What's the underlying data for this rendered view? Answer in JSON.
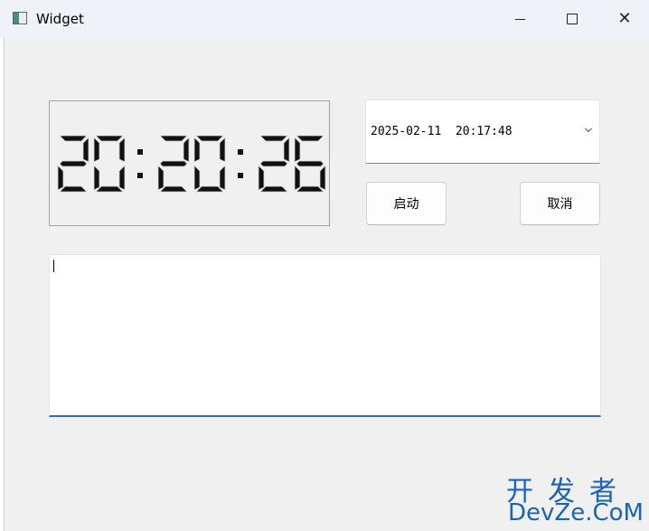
{
  "window": {
    "title": "Widget"
  },
  "clock": {
    "digits": [
      "2",
      "0",
      "2",
      "0",
      "2",
      "6"
    ]
  },
  "datetime_edit": {
    "value": "2025-02-11  20:17:48"
  },
  "buttons": {
    "start_label": "启动",
    "cancel_label": "取消"
  },
  "text_edit": {
    "value": ""
  },
  "watermark": {
    "line1": "开发者",
    "line2": "DevZe.CoM"
  },
  "icons": {
    "app": "app-window-icon",
    "minimize": "minimize-icon",
    "maximize": "maximize-icon",
    "close": "close-icon",
    "dropdown": "chevron-down-icon"
  }
}
